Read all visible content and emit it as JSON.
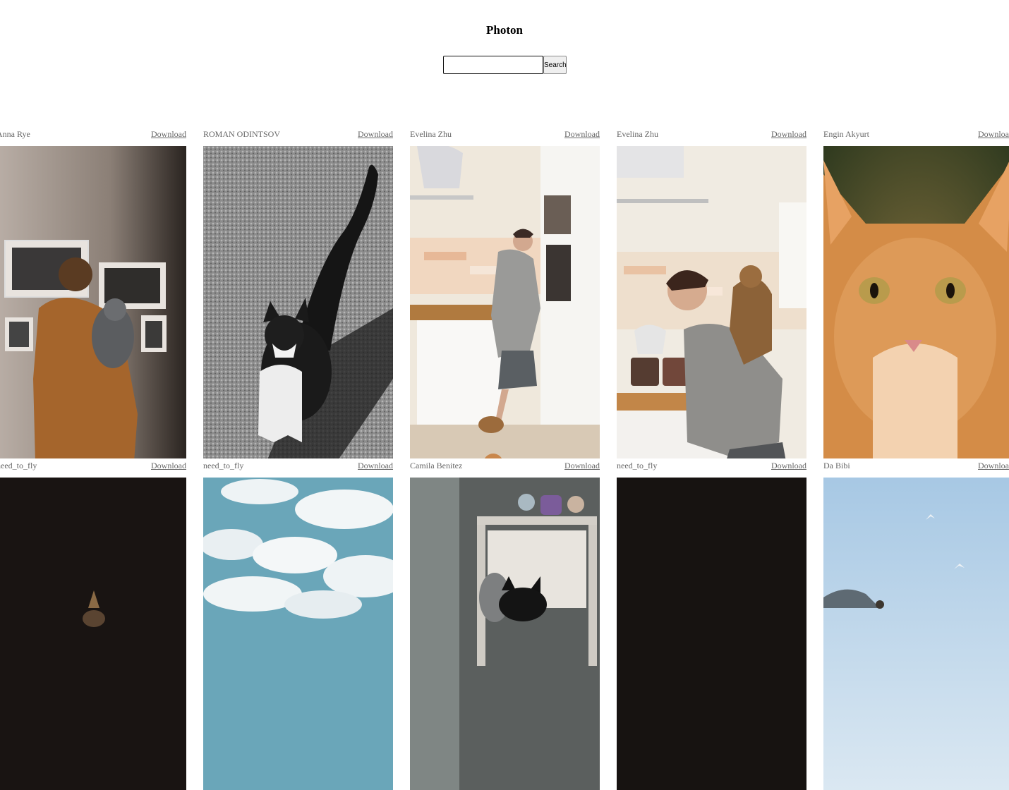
{
  "app": {
    "title": "Photon"
  },
  "search": {
    "placeholder": "",
    "value": "",
    "button_label": "Search"
  },
  "photos": [
    {
      "author": "Anna Rye",
      "download_label": "Download"
    },
    {
      "author": "ROMAN ODINTSOV",
      "download_label": "Download"
    },
    {
      "author": "Evelina Zhu",
      "download_label": "Download"
    },
    {
      "author": "Evelina Zhu",
      "download_label": "Download"
    },
    {
      "author": "Engin Akyurt",
      "download_label": "Download"
    },
    {
      "author": "need_to_fly",
      "download_label": "Download"
    },
    {
      "author": "need_to_fly",
      "download_label": "Download"
    },
    {
      "author": "Camila Benitez",
      "download_label": "Download"
    },
    {
      "author": "need_to_fly",
      "download_label": "Download"
    },
    {
      "author": "Da Bibi",
      "download_label": "Download"
    }
  ]
}
